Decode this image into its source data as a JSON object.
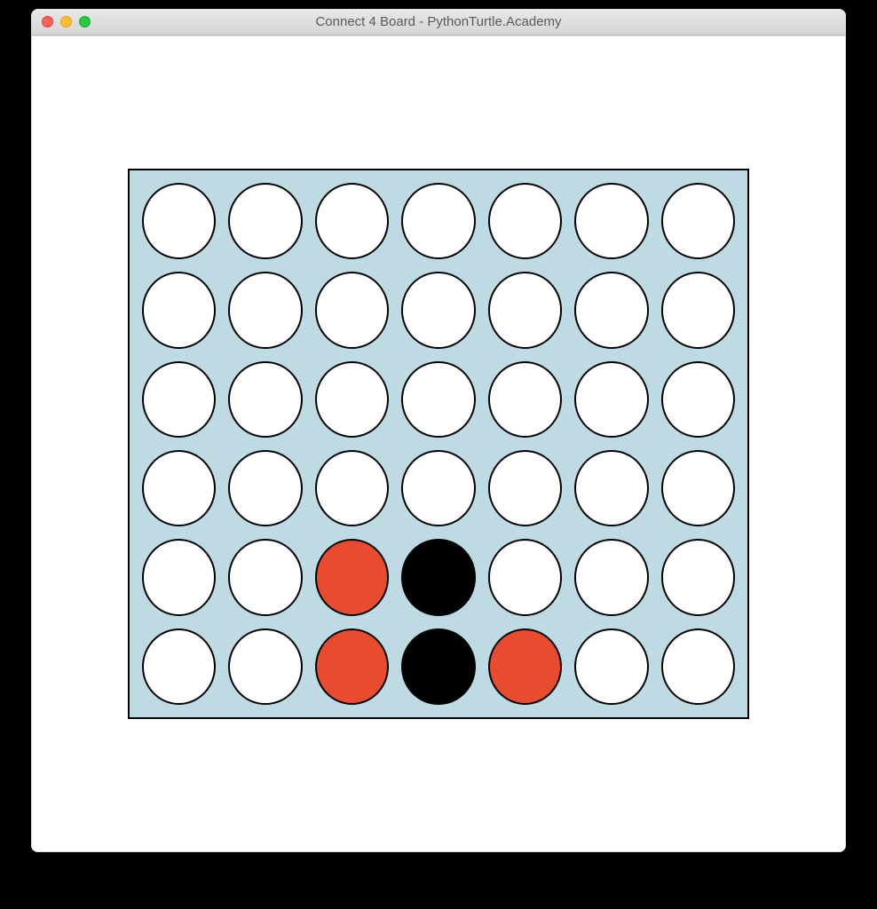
{
  "window": {
    "title": "Connect 4 Board - PythonTurtle.Academy"
  },
  "colors": {
    "board_background": "#bedae2",
    "empty_cell": "#ffffff",
    "red_piece": "#e84b2e",
    "black_piece": "#000000"
  },
  "game": {
    "columns": 7,
    "rows": 6,
    "board": [
      [
        "empty",
        "empty",
        "empty",
        "empty",
        "empty",
        "empty",
        "empty"
      ],
      [
        "empty",
        "empty",
        "empty",
        "empty",
        "empty",
        "empty",
        "empty"
      ],
      [
        "empty",
        "empty",
        "empty",
        "empty",
        "empty",
        "empty",
        "empty"
      ],
      [
        "empty",
        "empty",
        "empty",
        "empty",
        "empty",
        "empty",
        "empty"
      ],
      [
        "empty",
        "empty",
        "red",
        "black",
        "empty",
        "empty",
        "empty"
      ],
      [
        "empty",
        "empty",
        "red",
        "black",
        "red",
        "empty",
        "empty"
      ]
    ]
  }
}
